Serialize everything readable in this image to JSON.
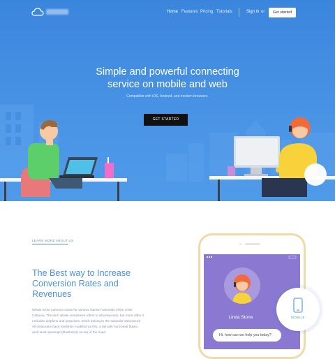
{
  "brand": {
    "logo": "cloud-icon"
  },
  "nav": {
    "links": [
      "Home",
      "Features",
      "Pricing",
      "Tutorials"
    ],
    "sign_in": "Sign in",
    "or": "or",
    "get_started": "Get started"
  },
  "hero": {
    "title_line1": "Simple and powerful connecting",
    "title_line2": "service on mobile and web",
    "subtitle": "Compatible with iOS, Android, and modern browsers.",
    "cta": "GET STARTED"
  },
  "about": {
    "eyebrow": "LEARN MORE ABOUT US",
    "heading": "The Best way to Increase Conversion Rates and Revenues",
    "paragraph": "Whale is the common name for various marine mammals of the order Cetacea. The term whale sometimes refers to all cetaceans, but more often it excludes dolphins and porpoises, which belong to the suborder Odontoceti. All cetaceans have forelimbs modified as fins, a tail with horizontal flukes, and nasal openings (blowholes) on top of the head."
  },
  "phone": {
    "agent_name": "Linda Stone",
    "chat_text": "Hi, how can we help you today?",
    "badge_label": "MOBILE",
    "badge_icon": "phone-icon"
  },
  "colors": {
    "hero_blue": "#4a94e6",
    "accent": "#4a90e2",
    "screen_purple": "#8a78d1",
    "cta_dark": "#111111"
  }
}
